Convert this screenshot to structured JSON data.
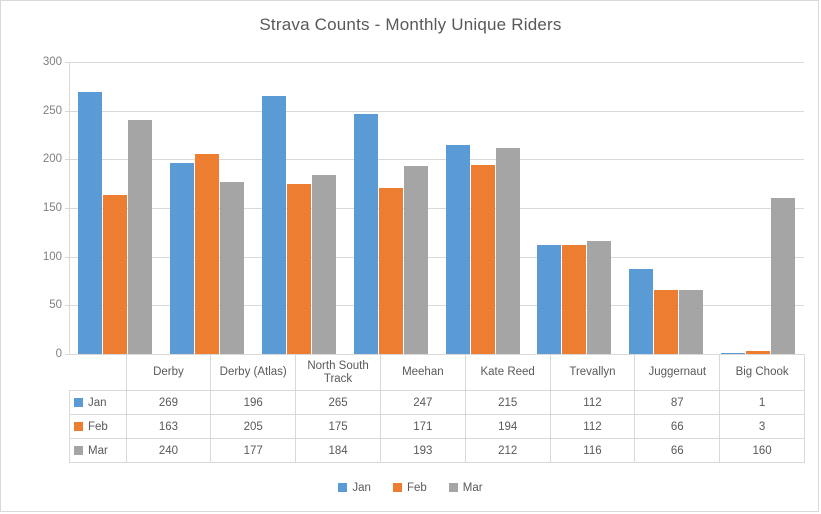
{
  "chart_data": {
    "type": "bar",
    "title": "Strava Counts - Monthly Unique Riders",
    "xlabel": "",
    "ylabel": "",
    "ylim": [
      0,
      300
    ],
    "yticks": [
      0,
      50,
      100,
      150,
      200,
      250,
      300
    ],
    "grid": true,
    "legend_position": "bottom",
    "categories": [
      "Derby",
      "Derby (Atlas)",
      "North South Track",
      "Meehan",
      "Kate Reed",
      "Trevallyn",
      "Juggernaut",
      "Big Chook"
    ],
    "series": [
      {
        "name": "Jan",
        "color": "#5b9bd5",
        "values": [
          269,
          196,
          265,
          247,
          215,
          112,
          87,
          1
        ]
      },
      {
        "name": "Feb",
        "color": "#ed7d31",
        "values": [
          163,
          205,
          175,
          171,
          194,
          112,
          66,
          3
        ]
      },
      {
        "name": "Mar",
        "color": "#a5a5a5",
        "values": [
          240,
          177,
          184,
          193,
          212,
          116,
          66,
          160
        ]
      }
    ],
    "data_table_shown": true
  },
  "axis": {
    "ytick_labels": [
      "300",
      "250",
      "200",
      "150",
      "100",
      "50",
      "0"
    ]
  },
  "table": {
    "category_labels": [
      "Derby",
      "Derby (Atlas)",
      "North South Track",
      "Meehan",
      "Kate Reed",
      "Trevallyn",
      "Juggernaut",
      "Big Chook"
    ],
    "rows": [
      {
        "label": "Jan",
        "values": [
          "269",
          "196",
          "265",
          "247",
          "215",
          "112",
          "87",
          "1"
        ]
      },
      {
        "label": "Feb",
        "values": [
          "163",
          "205",
          "175",
          "171",
          "194",
          "112",
          "66",
          "3"
        ]
      },
      {
        "label": "Mar",
        "values": [
          "240",
          "177",
          "184",
          "193",
          "212",
          "116",
          "66",
          "160"
        ]
      }
    ]
  },
  "legend": {
    "items": [
      "Jan",
      "Feb",
      "Mar"
    ]
  }
}
